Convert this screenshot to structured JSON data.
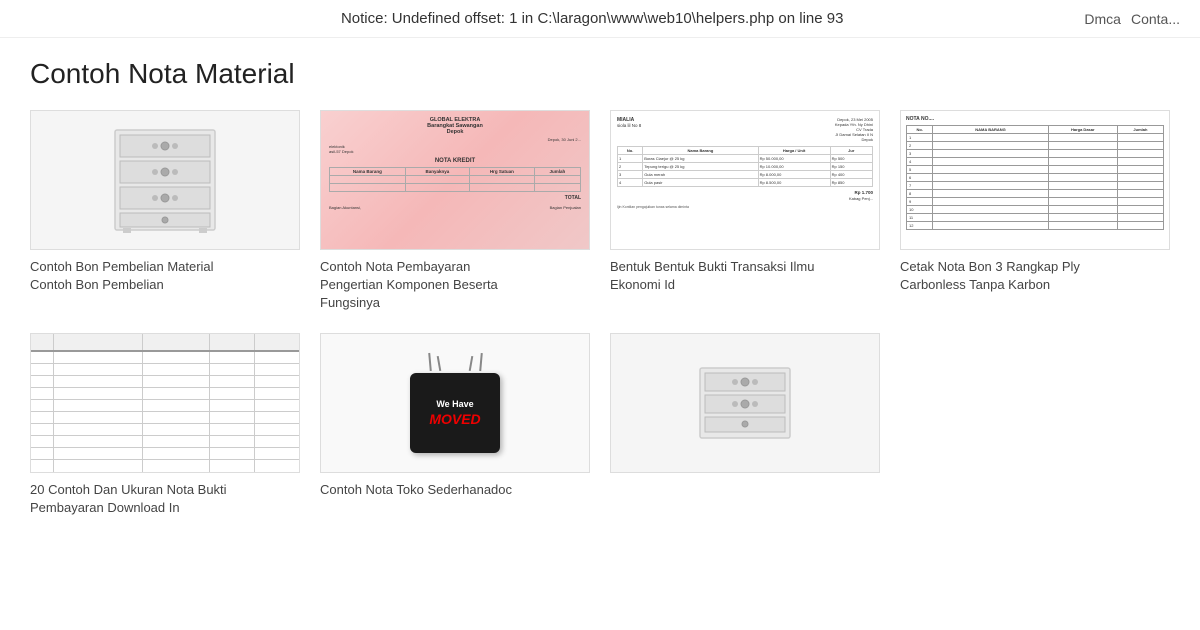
{
  "notice": {
    "text": "Notice: Undefined offset: 1 in C:\\laragon\\www\\web10\\helpers.php on line 93"
  },
  "nav": {
    "dmca": "Dmca",
    "contact": "Conta..."
  },
  "page": {
    "title": "Contoh Nota Material"
  },
  "cards": [
    {
      "id": "card-1",
      "type": "drawer",
      "caption_line1": "Contoh Bon Pembelian Material",
      "caption_line2": "Contoh Bon Pembelian"
    },
    {
      "id": "card-2",
      "type": "nota-kredit",
      "caption_line1": "Contoh Nota Pembayaran",
      "caption_line2": "Pengertian Komponen Beserta",
      "caption_line3": "Fungsinya"
    },
    {
      "id": "card-3",
      "type": "bukti-transaksi",
      "caption_line1": "Bentuk Bentuk Bukti Transaksi Ilmu",
      "caption_line2": "Ekonomi Id"
    },
    {
      "id": "card-4",
      "type": "nota-bon",
      "caption_line1": "Cetak Nota Bon 3 Rangkap Ply",
      "caption_line2": "Carbonless Tanpa Karbon"
    },
    {
      "id": "card-5",
      "type": "nota-grid",
      "caption_line1": "20 Contoh Dan Ukuran Nota Bukti",
      "caption_line2": "Pembayaran Download In"
    },
    {
      "id": "card-6",
      "type": "moved-sign",
      "moved_we_have": "We Have",
      "moved_text": "MOVED",
      "caption_line1": "Contoh Nota Toko Sederhanadoc"
    },
    {
      "id": "card-7",
      "type": "drawer-bottom",
      "caption_line1": ""
    }
  ]
}
